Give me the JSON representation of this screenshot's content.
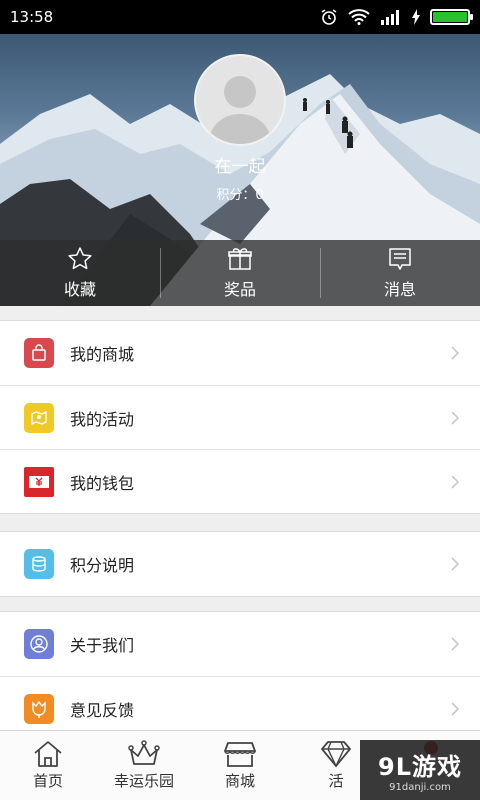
{
  "status_bar": {
    "time": "13:58"
  },
  "profile": {
    "name": "在一起",
    "points": "积分：0"
  },
  "hero_actions": [
    {
      "label": "收藏",
      "icon": "star-icon"
    },
    {
      "label": "奖品",
      "icon": "gift-icon"
    },
    {
      "label": "消息",
      "icon": "message-icon"
    }
  ],
  "menu": [
    {
      "label": "我的商城",
      "icon": "shopping-bag-icon",
      "color": "#d9484c"
    },
    {
      "label": "我的活动",
      "icon": "activity-map-icon",
      "color": "#f0c924"
    },
    {
      "label": "我的钱包",
      "icon": "wallet-icon",
      "color": "#d8262b"
    },
    {
      "label": "积分说明",
      "icon": "points-database-icon",
      "color": "#56bde8"
    },
    {
      "label": "关于我们",
      "icon": "about-person-icon",
      "color": "#6f7fd8"
    },
    {
      "label": "意见反馈",
      "icon": "feedback-tulip-icon",
      "color": "#f28b24"
    }
  ],
  "bottom_nav": [
    {
      "label": "首页",
      "icon": "home-icon"
    },
    {
      "label": "幸运乐园",
      "icon": "crown-icon"
    },
    {
      "label": "商城",
      "icon": "store-icon"
    },
    {
      "label": "活",
      "icon": "diamond-icon"
    }
  ],
  "watermark": {
    "main": "9L游戏",
    "sub": "91danji.com"
  }
}
